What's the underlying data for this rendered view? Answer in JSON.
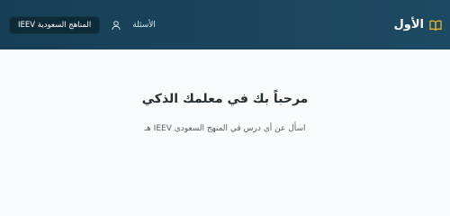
{
  "header": {
    "brand_title": "الأول",
    "nav_questions_label": "الأسئلة",
    "curriculum_button_label": "المناهج السعودية IEEV"
  },
  "main": {
    "welcome_title": "مرحباً بك في معلمك الذكي",
    "welcome_subtitle": "اسأل عن أي درس في المنهج السعودي IEEV هـ"
  },
  "colors": {
    "header_bg": "#163f55",
    "button_bg": "#0e2a39",
    "page_bg": "#f9fbfd"
  },
  "icons": {
    "brand": "open-book-icon",
    "user": "user-icon"
  }
}
